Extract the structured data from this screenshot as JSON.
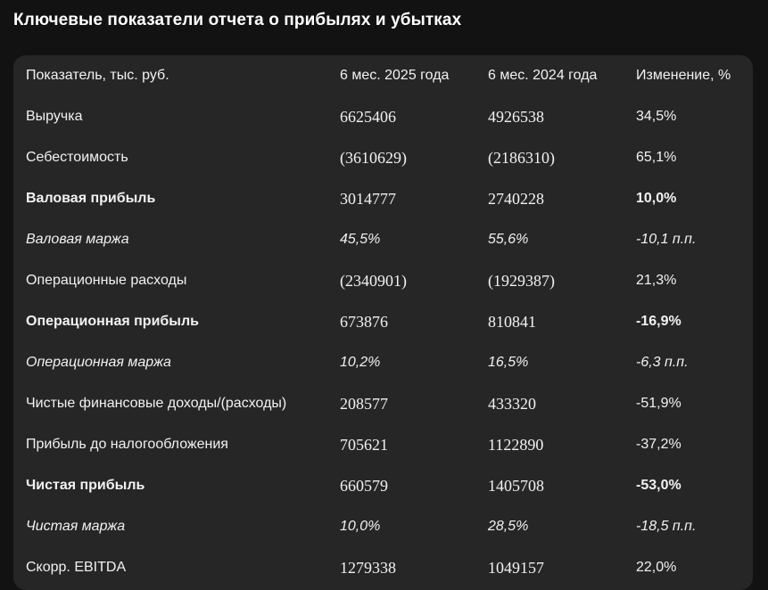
{
  "title": "Ключевые показатели отчета о прибылях и убытках",
  "table": {
    "headers": [
      "Показатель, тыс. руб.",
      "6 мес. 2025 года",
      "6 мес. 2024 года",
      "Изменение, %"
    ],
    "rows": [
      {
        "label": "Выручка",
        "v2025": "6625406",
        "v2024": "4926538",
        "change": "34,5%",
        "style": "normal"
      },
      {
        "label": "Себестоимость",
        "v2025": "(3610629)",
        "v2024": "(2186310)",
        "change": "65,1%",
        "style": "normal"
      },
      {
        "label": "Валовая прибыль",
        "v2025": "3014777",
        "v2024": "2740228",
        "change": "10,0%",
        "style": "bold"
      },
      {
        "label": "Валовая маржа",
        "v2025": "45,5%",
        "v2024": "55,6%",
        "change": "-10,1 п.п.",
        "style": "italic"
      },
      {
        "label": "Операционные расходы",
        "v2025": "(2340901)",
        "v2024": "(1929387)",
        "change": "21,3%",
        "style": "normal"
      },
      {
        "label": "Операционная прибыль",
        "v2025": "673876",
        "v2024": "810841",
        "change": "-16,9%",
        "style": "bold"
      },
      {
        "label": "Операционная маржа",
        "v2025": "10,2%",
        "v2024": "16,5%",
        "change": "-6,3 п.п.",
        "style": "italic"
      },
      {
        "label": "Чистые финансовые доходы/(расходы)",
        "v2025": "208577",
        "v2024": "433320",
        "change": "-51,9%",
        "style": "normal"
      },
      {
        "label": "Прибыль до налогообложения",
        "v2025": "705621",
        "v2024": "1122890",
        "change": "-37,2%",
        "style": "normal"
      },
      {
        "label": "Чистая прибыль",
        "v2025": "660579",
        "v2024": "1405708",
        "change": "-53,0%",
        "style": "bold"
      },
      {
        "label": "Чистая маржа",
        "v2025": "10,0%",
        "v2024": "28,5%",
        "change": "-18,5 п.п.",
        "style": "italic"
      },
      {
        "label": "Скорр. EBITDA",
        "v2025": "1279338",
        "v2024": "1049157",
        "change": "22,0%",
        "style": "normal"
      }
    ]
  }
}
